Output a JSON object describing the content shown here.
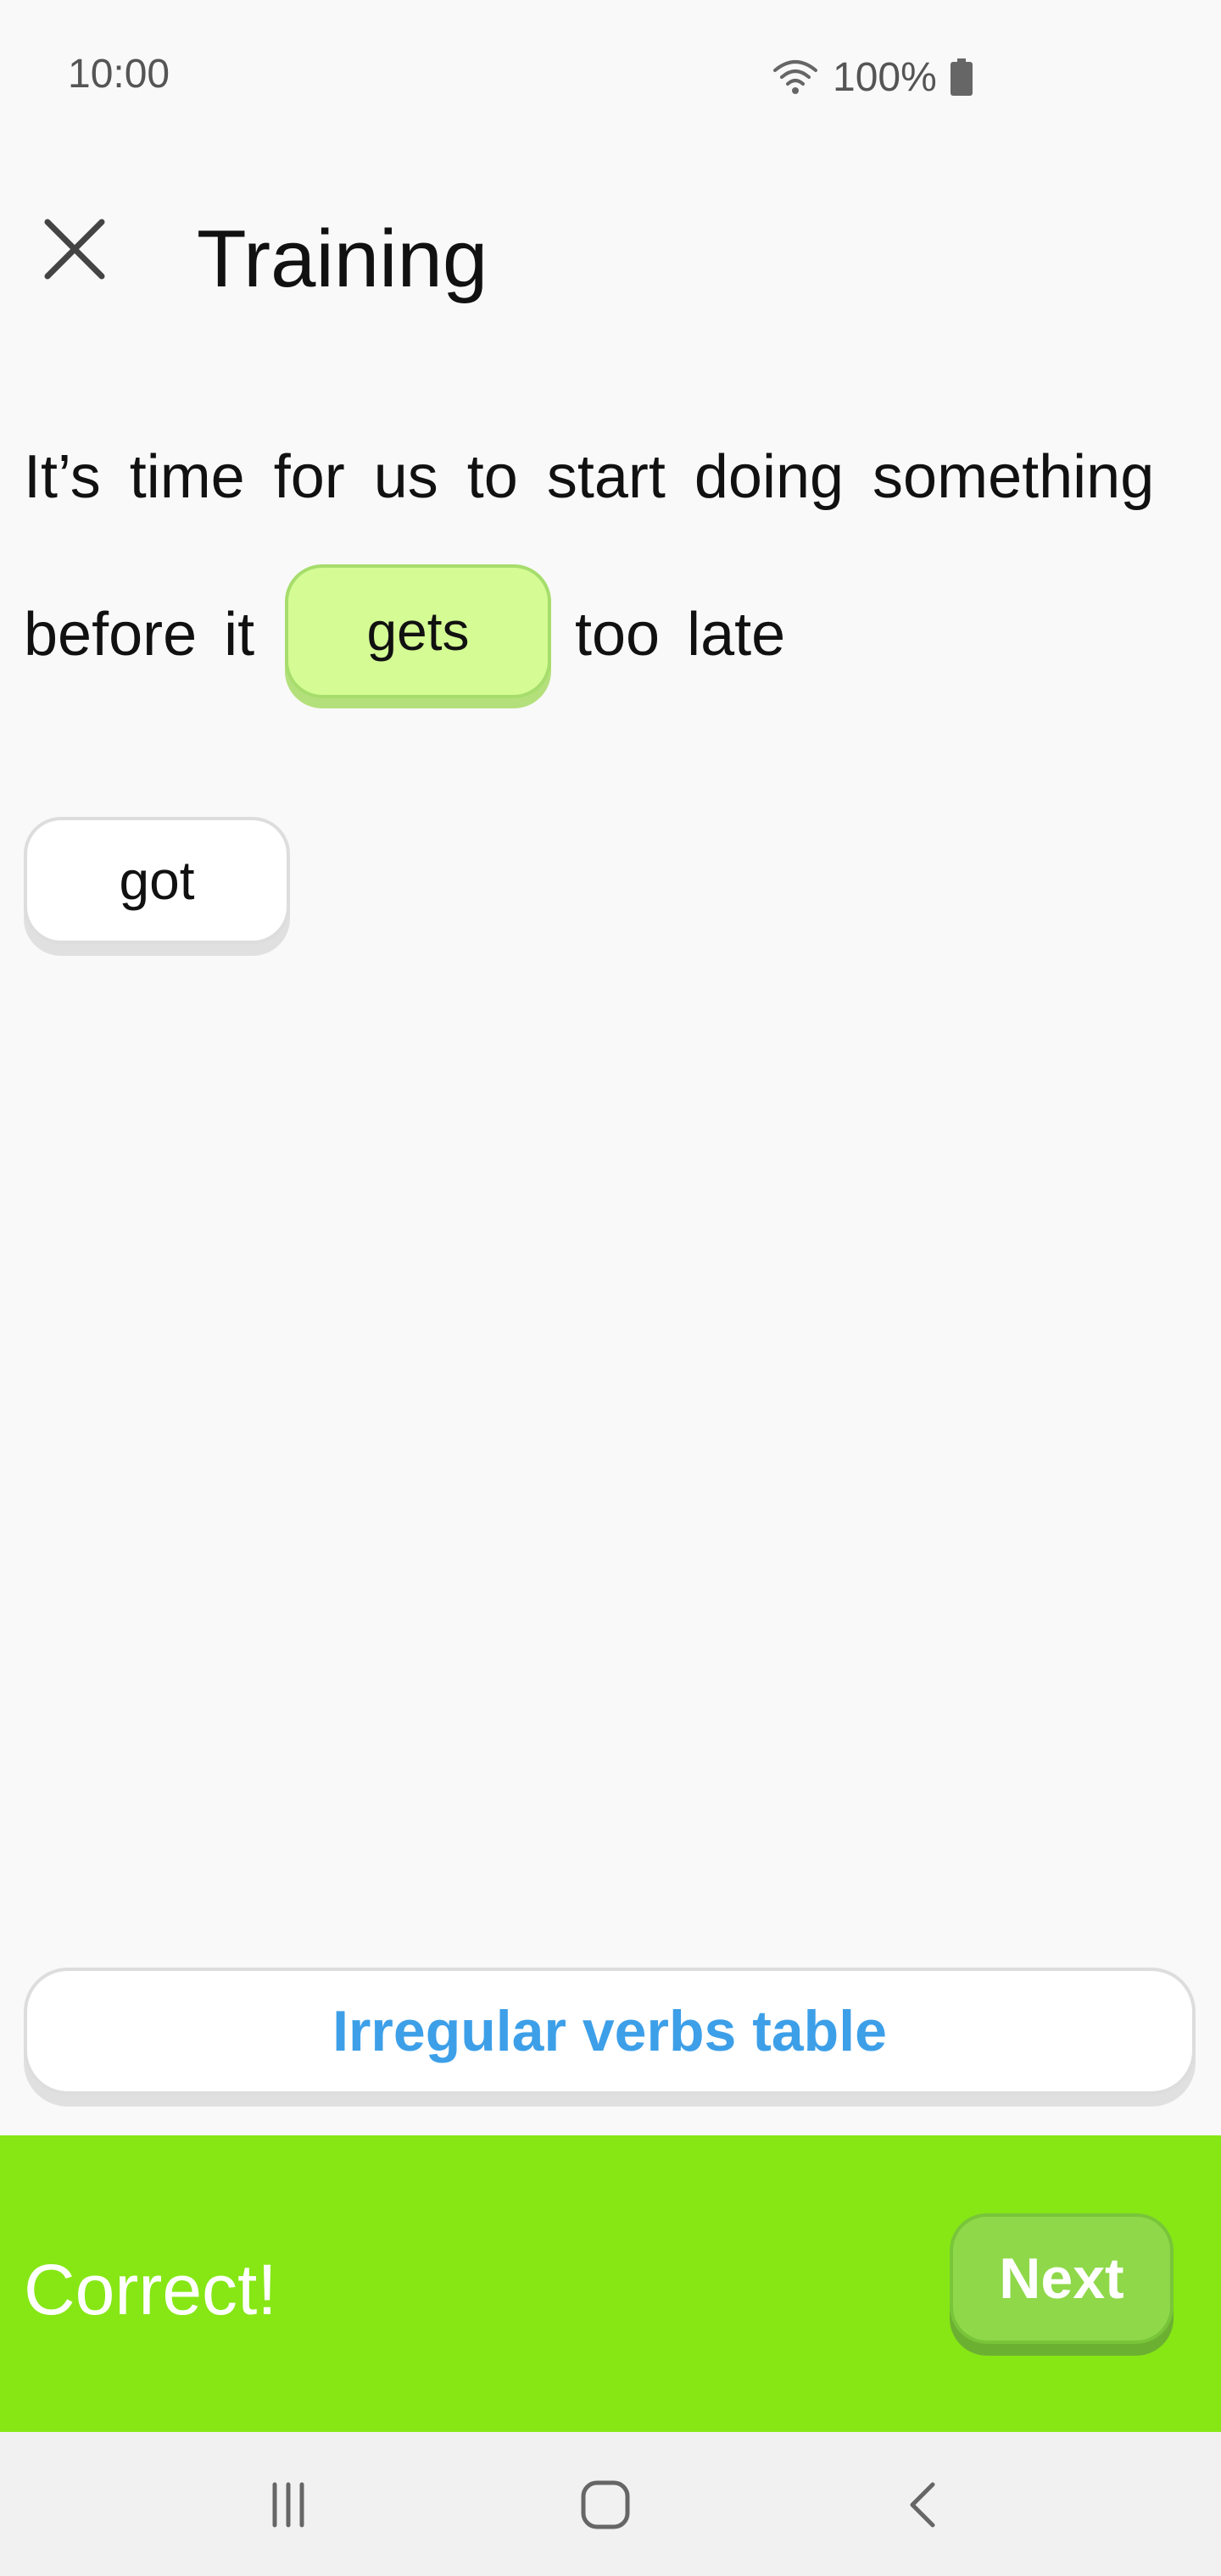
{
  "status_bar": {
    "time": "10:00",
    "battery": "100%",
    "icons": [
      "wifi-icon",
      "battery-icon"
    ]
  },
  "header": {
    "title": "Training",
    "close_icon": "close-icon"
  },
  "exercise": {
    "sentence_line1": "It’s time for us to start doing something",
    "sentence_before": "before it",
    "filled_answer": "gets",
    "sentence_after": "too late",
    "options": [
      "got"
    ]
  },
  "verbs_table_button": "Irregular verbs table",
  "result": {
    "message": "Correct!",
    "next_label": "Next"
  },
  "colors": {
    "accent_green": "#86e715",
    "answer_chip": "#d4fb94",
    "link_blue": "#3d9fe8"
  },
  "nav_bar": {
    "icons": [
      "recents-icon",
      "home-icon",
      "back-icon"
    ]
  }
}
